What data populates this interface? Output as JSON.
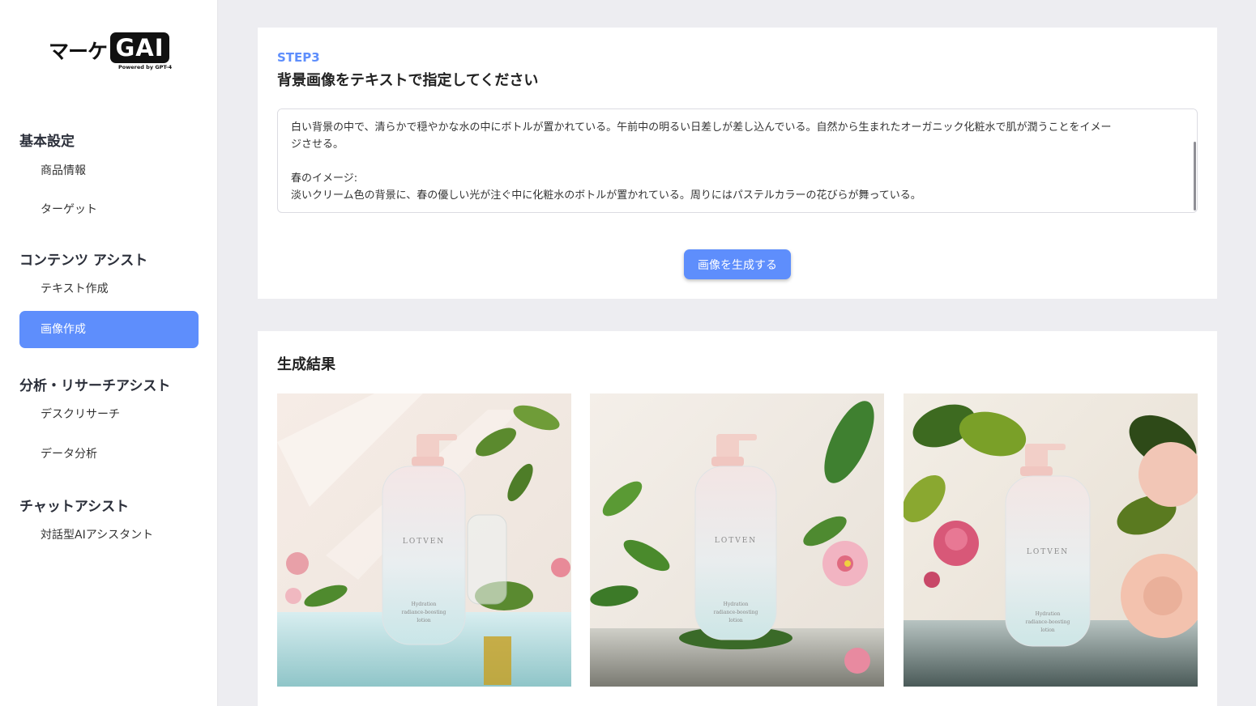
{
  "logo": {
    "kana": "マーケ",
    "box": "GAI",
    "sub": "Powered by GPT-4"
  },
  "sidebar": {
    "sections": [
      {
        "title": "基本設定",
        "items": [
          "商品情報",
          "ターゲット"
        ]
      },
      {
        "title": "コンテンツ アシスト",
        "items": [
          "テキスト作成",
          "画像作成"
        ]
      },
      {
        "title": "分析・リサーチアシスト",
        "items": [
          "デスクリサーチ",
          "データ分析"
        ]
      },
      {
        "title": "チャットアシスト",
        "items": [
          "対話型AIアシスタント"
        ]
      }
    ],
    "active_item": "画像作成"
  },
  "step": {
    "label": "STEP3",
    "title": "背景画像をテキストで指定してください",
    "prompt_text": "白い背景の中で、清らかで穏やかな水の中にボトルが置かれている。午前中の明るい日差しが差し込んでいる。自然から生まれたオーガニック化粧水で肌が潤うことをイメー\nジさせる。\n\n春のイメージ:\n淡いクリーム色の背景に、春の優しい光が注ぐ中に化粧水のボトルが置かれている。周りにはパステルカラーの花びらが舞っている。",
    "button_label": "画像を生成する"
  },
  "results": {
    "title": "生成結果",
    "images": [
      {
        "brand": "LOTVEN",
        "label_lines": [
          "Hydration",
          "radiance-boosting",
          "lotion"
        ]
      },
      {
        "brand": "LOTVEN",
        "label_lines": [
          "Hydration",
          "radiance-boosting",
          "lotion"
        ]
      },
      {
        "brand": "LOTVEN",
        "label_lines": [
          "Hydration",
          "radiance-boosting",
          "lotion"
        ]
      }
    ]
  },
  "colors": {
    "accent": "#5e8efc",
    "page_bg": "#ededf1",
    "card_bg": "#ffffff"
  }
}
